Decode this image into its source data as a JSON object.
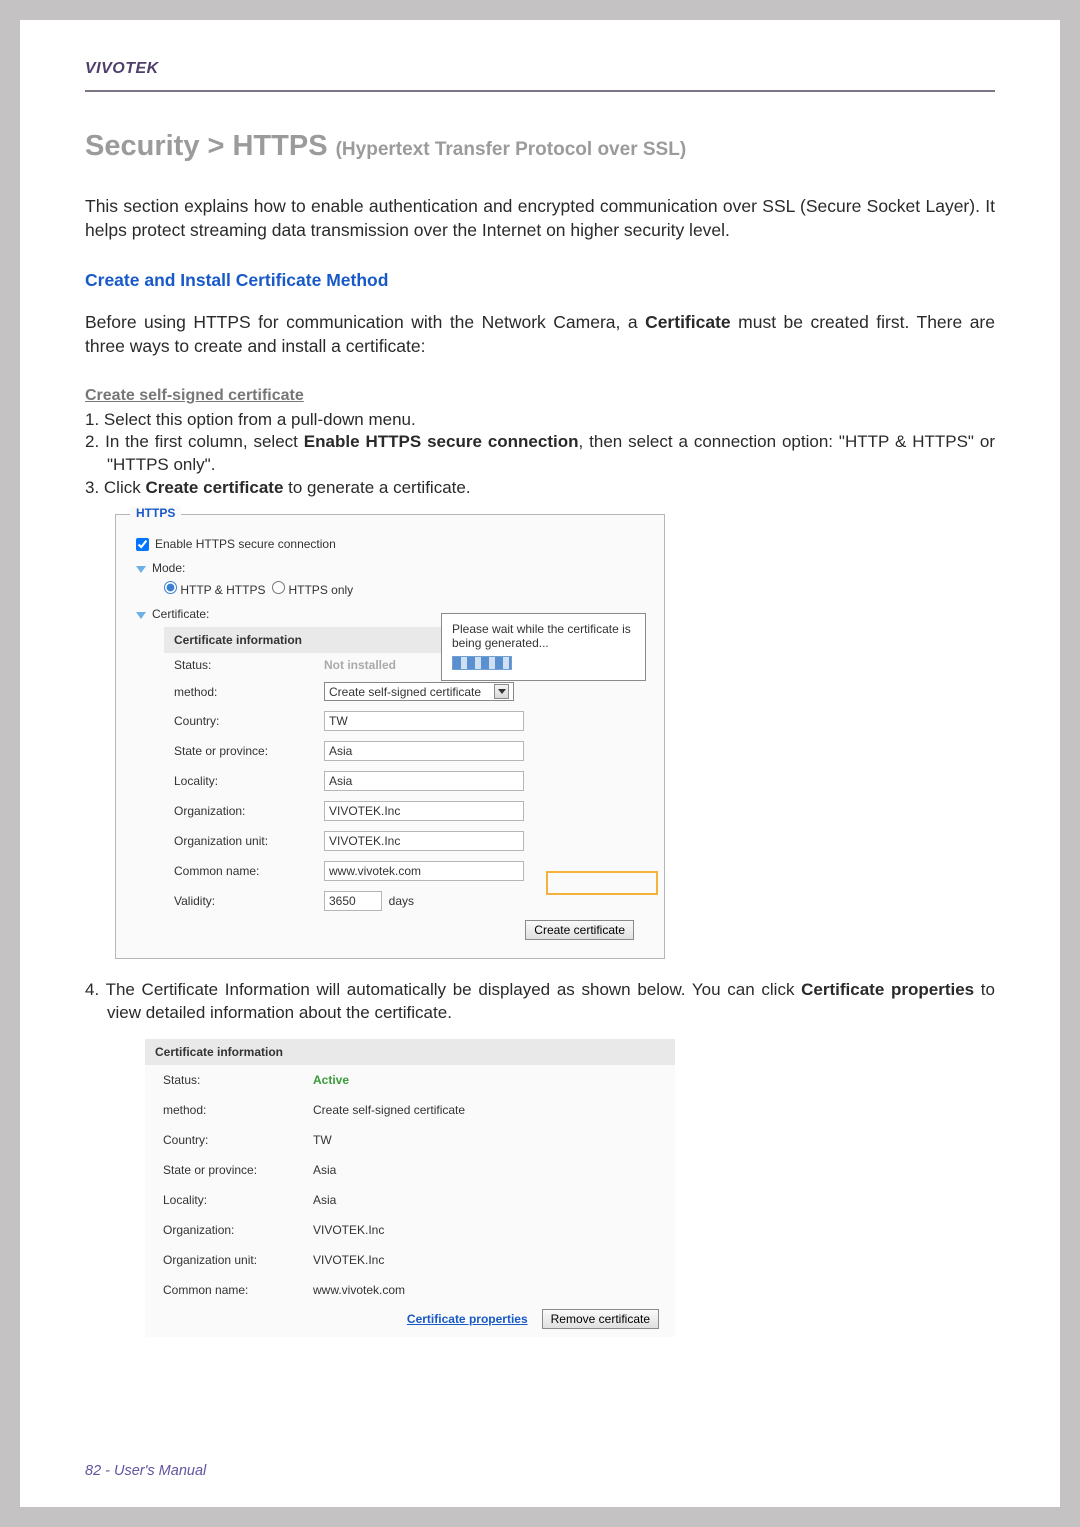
{
  "header": {
    "brand": "VIVOTEK"
  },
  "title": {
    "main": "Security >  HTTPS ",
    "sub": "(Hypertext Transfer Protocol over SSL)"
  },
  "intro": "This section explains how to enable authentication and encrypted communication over SSL (Secure Socket Layer). It helps protect streaming data transmission over the Internet on higher security level.",
  "section_heading": "Create and Install Certificate Method",
  "intro2_a": "Before using HTTPS for communication with the Network Camera, a ",
  "intro2_b": "Certificate",
  "intro2_c": " must be created first. There are three ways to create and install a certificate:",
  "h3": "Create self-signed certificate",
  "steps": {
    "s1": "1. Select this option from a pull-down menu.",
    "s2a": "2. In the first column, select ",
    "s2b": "Enable HTTPS secure connection",
    "s2c": ", then select a connection option: \"HTTP & HTTPS\" or \"HTTPS only\".",
    "s3a": "3. Click ",
    "s3b": "Create certificate",
    "s3c": " to generate a certificate."
  },
  "panel1": {
    "legend": "HTTPS",
    "enable_label": "Enable HTTPS secure connection",
    "mode_label": "Mode:",
    "mode_opt1": "HTTP & HTTPS",
    "mode_opt2": "HTTPS only",
    "cert_label": "Certificate:",
    "cert_info_hdr": "Certificate information",
    "rows": {
      "status_l": "Status:",
      "status_v": "Not installed",
      "method_l": "method:",
      "method_v": "Create self-signed certificate",
      "country_l": "Country:",
      "country_v": "TW",
      "state_l": "State or province:",
      "state_v": "Asia",
      "locality_l": "Locality:",
      "locality_v": "Asia",
      "org_l": "Organization:",
      "org_v": "VIVOTEK.Inc",
      "orgu_l": "Organization unit:",
      "orgu_v": "VIVOTEK.Inc",
      "cn_l": "Common name:",
      "cn_v": "www.vivotek.com",
      "validity_l": "Validity:",
      "validity_v": "3650",
      "validity_unit": "days"
    },
    "create_btn": "Create certificate",
    "wait_msg": "Please wait while the certificate is being generated..."
  },
  "step4_a": "4. The Certificate Information will automatically be displayed as shown below. You can click ",
  "step4_b": "Certificate properties",
  "step4_c": " to view detailed information about the certificate.",
  "panel2": {
    "cert_info_hdr": "Certificate information",
    "rows": {
      "status_l": "Status:",
      "status_v": "Active",
      "method_l": "method:",
      "method_v": "Create self-signed certificate",
      "country_l": "Country:",
      "country_v": "TW",
      "state_l": "State or province:",
      "state_v": "Asia",
      "locality_l": "Locality:",
      "locality_v": "Asia",
      "org_l": "Organization:",
      "org_v": "VIVOTEK.Inc",
      "orgu_l": "Organization unit:",
      "orgu_v": "VIVOTEK.Inc",
      "cn_l": "Common name:",
      "cn_v": "www.vivotek.com"
    },
    "cert_props": "Certificate properties",
    "remove_btn": "Remove certificate"
  },
  "footer": "82 - User's Manual"
}
